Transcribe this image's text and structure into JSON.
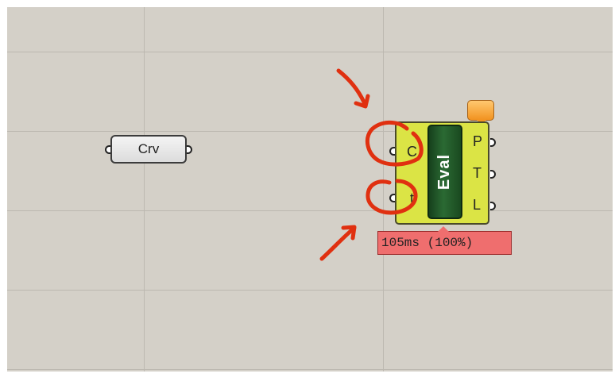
{
  "canvas": {
    "background_color": "#d4d0c8",
    "grid_color": "#bcb8b0"
  },
  "crv_param": {
    "label": "Crv",
    "icon": "curve-param-icon"
  },
  "eval_component": {
    "name": "Eval",
    "inputs": [
      "C",
      "t"
    ],
    "outputs": [
      "P",
      "T",
      "L"
    ],
    "body_color": "#dbe445",
    "center_color": "#2b6a33"
  },
  "timer": {
    "text": "105ms (100%)",
    "color": "#ef6e6e"
  },
  "annotations": {
    "color": "#e03010"
  }
}
